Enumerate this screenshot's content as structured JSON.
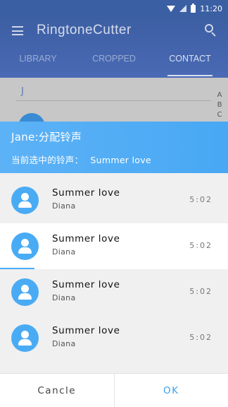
{
  "status_bar": {
    "time": "11:20"
  },
  "app": {
    "title": "RingtoneCutter",
    "tabs": [
      {
        "label": "LIBRARY",
        "active": false
      },
      {
        "label": "CROPPED",
        "active": false
      },
      {
        "label": "CONTACT",
        "active": true
      }
    ],
    "section_letter": "J",
    "index_letters": [
      "A",
      "B",
      "C"
    ]
  },
  "dialog": {
    "title": "Jane:分配铃声",
    "current_label": "当前选中的铃声：",
    "current_value": "Summer love",
    "songs": [
      {
        "title": "Summer love",
        "artist": "Diana",
        "duration": "5:02",
        "selected": false
      },
      {
        "title": "Summer love",
        "artist": "Diana",
        "duration": "5:02",
        "selected": true,
        "progress": 0.15
      },
      {
        "title": "Summer love",
        "artist": "Diana",
        "duration": "5:02",
        "selected": false
      },
      {
        "title": "Summer love",
        "artist": "Diana",
        "duration": "5:02",
        "selected": false
      }
    ],
    "cancel_label": "Cancle",
    "ok_label": "OK"
  },
  "colors": {
    "accent": "#4aabf5",
    "header_gradient_start": "#5db2f6",
    "appbar": "#3c5ea2"
  }
}
